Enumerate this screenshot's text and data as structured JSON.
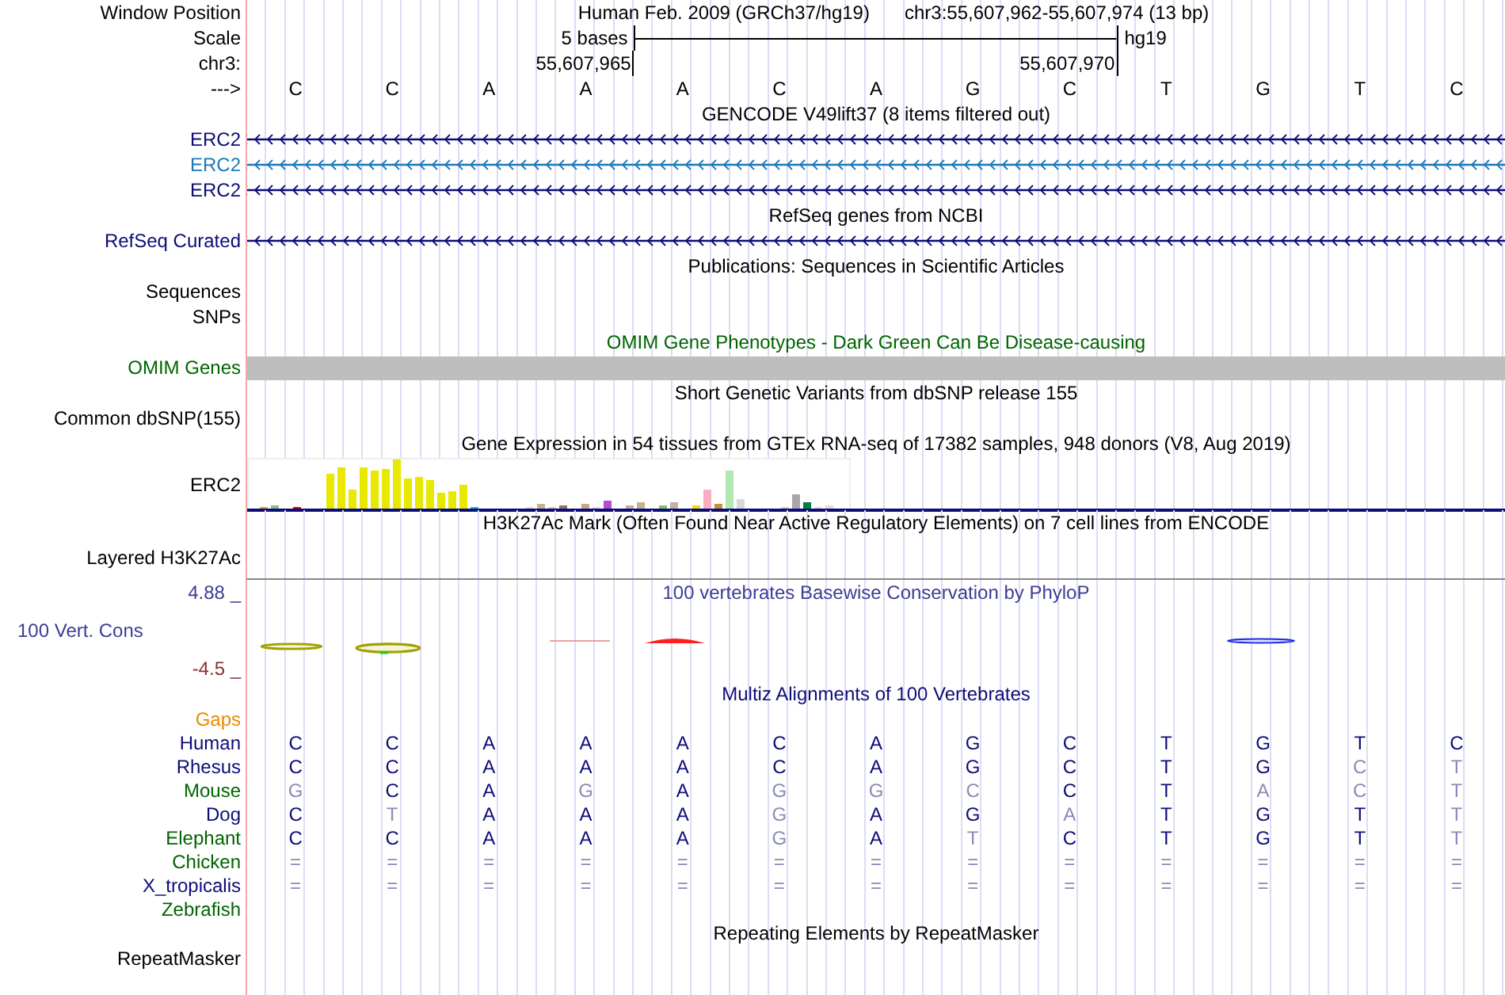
{
  "header": {
    "position_label": "Window Position",
    "assembly_title": "Human Feb. 2009 (GRCh37/hg19)",
    "position": "chr3:55,607,962-55,607,974 (13 bp)",
    "scale_label": "Scale",
    "scale_length": "5 bases",
    "assembly": "hg19",
    "chrom_label": "chr3:",
    "coord_start": "55,607,965",
    "coord_end": "55,607,970",
    "strand_label": "--->",
    "bases": [
      "C",
      "C",
      "A",
      "A",
      "A",
      "C",
      "A",
      "G",
      "C",
      "T",
      "G",
      "T",
      "C"
    ]
  },
  "tracks": [
    {
      "kind": "genes",
      "title": {
        "text": "GENCODE V49lift37 (8 items filtered out)",
        "color": "#000000"
      },
      "items": [
        {
          "label": "ERC2",
          "color": "#0c0c78"
        },
        {
          "label": "ERC2",
          "color": "#1c78b8"
        },
        {
          "label": "ERC2",
          "color": "#0c0c78"
        }
      ]
    },
    {
      "kind": "genes",
      "title": {
        "text": "RefSeq genes from NCBI",
        "color": "#000000"
      },
      "items": [
        {
          "label": "RefSeq Curated",
          "color": "#0c0c78"
        }
      ]
    },
    {
      "kind": "empty",
      "title": {
        "text": "Publications: Sequences in Scientific Articles",
        "color": "#000000"
      },
      "items": [
        {
          "label": "Sequences",
          "color": "#000000"
        },
        {
          "label": "SNPs",
          "color": "#000000"
        }
      ]
    },
    {
      "kind": "bar",
      "title": {
        "text": "OMIM Gene Phenotypes - Dark Green Can Be Disease-causing",
        "color": "#006400"
      },
      "items": [
        {
          "label": "OMIM Genes",
          "color": "#006400"
        }
      ]
    },
    {
      "kind": "empty",
      "title": {
        "text": "Short Genetic Variants from dbSNP release 155",
        "color": "#000000"
      },
      "items": [
        {
          "label": "Common dbSNP(155)",
          "color": "#000000"
        }
      ]
    },
    {
      "kind": "expression",
      "title": {
        "text": "Gene Expression in 54 tissues from GTEx RNA-seq of 17382 samples, 948 donors (V8, Aug 2019)",
        "color": "#000000"
      },
      "items": [
        {
          "label": "ERC2",
          "color": "#000000"
        }
      ]
    },
    {
      "kind": "marks",
      "title": {
        "text": "H3K27Ac Mark (Often Found Near Active Regulatory Elements) on 7 cell lines from ENCODE",
        "color": "#000000"
      },
      "items": [
        {
          "label": "Layered H3K27Ac",
          "color": "#000000"
        }
      ]
    },
    {
      "kind": "wiggle",
      "title": {
        "text": "100 vertebrates Basewise Conservation by PhyloP",
        "color": "#3c3c96"
      },
      "max_label": {
        "text": "4.88 _",
        "color": "#3c3c96"
      },
      "min_label": {
        "text": "-4.5 _",
        "color": "#8a3030"
      },
      "items": [
        {
          "label": "100 Vert. Cons",
          "color": "#3c3c96"
        }
      ]
    },
    {
      "kind": "alignment",
      "title": {
        "text": "Multiz Alignments of 100 Vertebrates",
        "color": "#0c0c78"
      },
      "items": [
        {
          "label": "Gaps",
          "color": "#e88a00"
        },
        {
          "label": "Human",
          "color": "#0c0c78",
          "bases": [
            {
              "base": "C",
              "match": true
            },
            {
              "base": "C",
              "match": true
            },
            {
              "base": "A",
              "match": true
            },
            {
              "base": "A",
              "match": true
            },
            {
              "base": "A",
              "match": true
            },
            {
              "base": "C",
              "match": true
            },
            {
              "base": "A",
              "match": true
            },
            {
              "base": "G",
              "match": true
            },
            {
              "base": "C",
              "match": true
            },
            {
              "base": "T",
              "match": true
            },
            {
              "base": "G",
              "match": true
            },
            {
              "base": "T",
              "match": true
            },
            {
              "base": "C",
              "match": true
            }
          ]
        },
        {
          "label": "Rhesus",
          "color": "#0c0c78",
          "bases": [
            {
              "base": "C",
              "match": true
            },
            {
              "base": "C",
              "match": true
            },
            {
              "base": "A",
              "match": true
            },
            {
              "base": "A",
              "match": true
            },
            {
              "base": "A",
              "match": true
            },
            {
              "base": "C",
              "match": true
            },
            {
              "base": "A",
              "match": true
            },
            {
              "base": "G",
              "match": true
            },
            {
              "base": "C",
              "match": true
            },
            {
              "base": "T",
              "match": true
            },
            {
              "base": "G",
              "match": true
            },
            {
              "base": "C",
              "match": false
            },
            {
              "base": "T",
              "match": false
            }
          ]
        },
        {
          "label": "Mouse",
          "color": "#006400",
          "bases": [
            {
              "base": "G",
              "match": false
            },
            {
              "base": "C",
              "match": true
            },
            {
              "base": "A",
              "match": true
            },
            {
              "base": "G",
              "match": false
            },
            {
              "base": "A",
              "match": true
            },
            {
              "base": "G",
              "match": false
            },
            {
              "base": "G",
              "match": false
            },
            {
              "base": "C",
              "match": false
            },
            {
              "base": "C",
              "match": true
            },
            {
              "base": "T",
              "match": true
            },
            {
              "base": "A",
              "match": false
            },
            {
              "base": "C",
              "match": false
            },
            {
              "base": "T",
              "match": false
            }
          ]
        },
        {
          "label": "Dog",
          "color": "#0c0c78",
          "bases": [
            {
              "base": "C",
              "match": true
            },
            {
              "base": "T",
              "match": false
            },
            {
              "base": "A",
              "match": true
            },
            {
              "base": "A",
              "match": true
            },
            {
              "base": "A",
              "match": true
            },
            {
              "base": "G",
              "match": false
            },
            {
              "base": "A",
              "match": true
            },
            {
              "base": "G",
              "match": true
            },
            {
              "base": "A",
              "match": false
            },
            {
              "base": "T",
              "match": true
            },
            {
              "base": "G",
              "match": true
            },
            {
              "base": "T",
              "match": true
            },
            {
              "base": "T",
              "match": false
            }
          ]
        },
        {
          "label": "Elephant",
          "color": "#006400",
          "bases": [
            {
              "base": "C",
              "match": true
            },
            {
              "base": "C",
              "match": true
            },
            {
              "base": "A",
              "match": true
            },
            {
              "base": "A",
              "match": true
            },
            {
              "base": "A",
              "match": true
            },
            {
              "base": "G",
              "match": false
            },
            {
              "base": "A",
              "match": true
            },
            {
              "base": "T",
              "match": false
            },
            {
              "base": "C",
              "match": true
            },
            {
              "base": "T",
              "match": true
            },
            {
              "base": "G",
              "match": true
            },
            {
              "base": "T",
              "match": true
            },
            {
              "base": "T",
              "match": false
            }
          ]
        },
        {
          "label": "Chicken",
          "color": "#006400",
          "bases": [
            {
              "base": "=",
              "match": false
            },
            {
              "base": "=",
              "match": false
            },
            {
              "base": "=",
              "match": false
            },
            {
              "base": "=",
              "match": false
            },
            {
              "base": "=",
              "match": false
            },
            {
              "base": "=",
              "match": false
            },
            {
              "base": "=",
              "match": false
            },
            {
              "base": "=",
              "match": false
            },
            {
              "base": "=",
              "match": false
            },
            {
              "base": "=",
              "match": false
            },
            {
              "base": "=",
              "match": false
            },
            {
              "base": "=",
              "match": false
            },
            {
              "base": "=",
              "match": false
            }
          ]
        },
        {
          "label": "X_tropicalis",
          "color": "#0c0c78",
          "bases": [
            {
              "base": "=",
              "match": false
            },
            {
              "base": "=",
              "match": false
            },
            {
              "base": "=",
              "match": false
            },
            {
              "base": "=",
              "match": false
            },
            {
              "base": "=",
              "match": false
            },
            {
              "base": "=",
              "match": false
            },
            {
              "base": "=",
              "match": false
            },
            {
              "base": "=",
              "match": false
            },
            {
              "base": "=",
              "match": false
            },
            {
              "base": "=",
              "match": false
            },
            {
              "base": "=",
              "match": false
            },
            {
              "base": "=",
              "match": false
            },
            {
              "base": "=",
              "match": false
            }
          ]
        },
        {
          "label": "Zebrafish",
          "color": "#006400"
        }
      ]
    },
    {
      "kind": "empty",
      "title": {
        "text": "Repeating Elements by RepeatMasker",
        "color": "#000000"
      },
      "items": [
        {
          "label": "RepeatMasker",
          "color": "#000000"
        }
      ]
    }
  ]
}
